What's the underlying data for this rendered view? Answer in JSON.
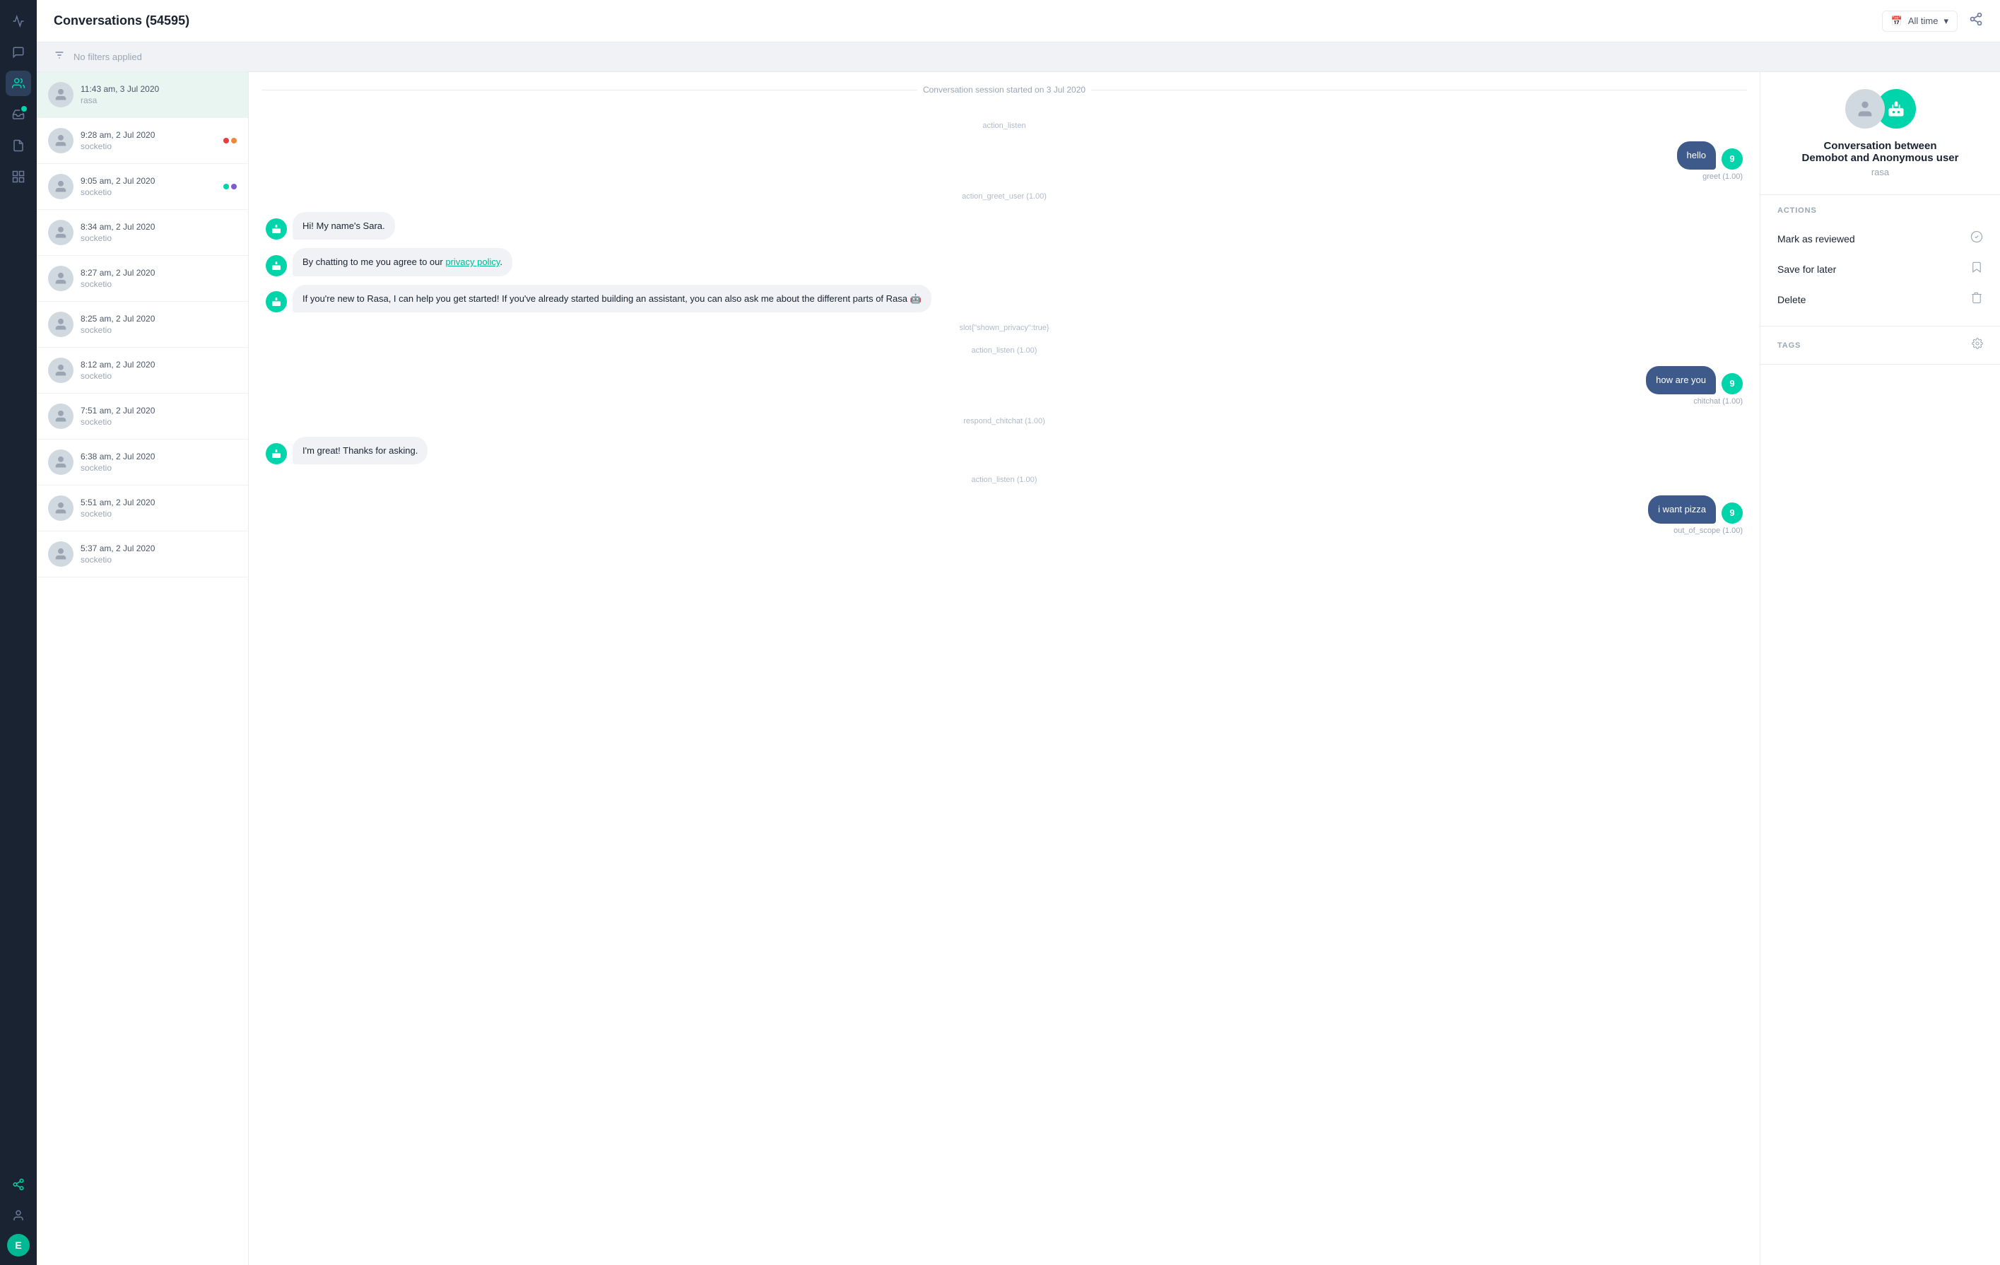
{
  "sidebar": {
    "icons": [
      "chart-line",
      "chat-bubble",
      "conversations",
      "inbox",
      "document",
      "analytics",
      "person"
    ],
    "avatar_letter": "E"
  },
  "header": {
    "title": "Conversations (54595)",
    "time_filter": "All time",
    "share_label": "share"
  },
  "filter_bar": {
    "placeholder": "No filters applied"
  },
  "conv_list": {
    "items": [
      {
        "time": "11:43 am, 3 Jul 2020",
        "name": "rasa",
        "dots": [],
        "selected": true
      },
      {
        "time": "9:28 am, 2 Jul 2020",
        "name": "socketio",
        "dots": [
          "red",
          "orange"
        ],
        "selected": false
      },
      {
        "time": "9:05 am, 2 Jul 2020",
        "name": "socketio",
        "dots": [
          "teal",
          "purple"
        ],
        "selected": false
      },
      {
        "time": "8:34 am, 2 Jul 2020",
        "name": "socketio",
        "dots": [],
        "selected": false
      },
      {
        "time": "8:27 am, 2 Jul 2020",
        "name": "socketio",
        "dots": [],
        "selected": false
      },
      {
        "time": "8:25 am, 2 Jul 2020",
        "name": "socketio",
        "dots": [],
        "selected": false
      },
      {
        "time": "8:12 am, 2 Jul 2020",
        "name": "socketio",
        "dots": [],
        "selected": false
      },
      {
        "time": "7:51 am, 2 Jul 2020",
        "name": "socketio",
        "dots": [],
        "selected": false
      },
      {
        "time": "6:38 am, 2 Jul 2020",
        "name": "socketio",
        "dots": [],
        "selected": false
      },
      {
        "time": "5:51 am, 2 Jul 2020",
        "name": "socketio",
        "dots": [],
        "selected": false
      },
      {
        "time": "5:37 am, 2 Jul 2020",
        "name": "socketio",
        "dots": [],
        "selected": false
      }
    ]
  },
  "chat": {
    "session_header": "Conversation session started on 3 Jul 2020",
    "messages": [
      {
        "type": "action",
        "text": "action_listen"
      },
      {
        "type": "user",
        "text": "hello",
        "intent": "greet (1.00)",
        "num": "9"
      },
      {
        "type": "action",
        "text": "action_greet_user (1.00)"
      },
      {
        "type": "bot",
        "text": "Hi! My name's Sara."
      },
      {
        "type": "bot",
        "text": "By chatting to me you agree to our privacy policy.",
        "has_link": true
      },
      {
        "type": "bot",
        "text": "If you're new to Rasa, I can help you get started! If you've already started building an assistant, you can also ask me about the different parts of Rasa 🤖"
      },
      {
        "type": "slot",
        "text": "slot{\"shown_privacy\":true}"
      },
      {
        "type": "action",
        "text": "action_listen (1.00)"
      },
      {
        "type": "user",
        "text": "how are you",
        "intent": "chitchat (1.00)",
        "num": "9"
      },
      {
        "type": "action",
        "text": "respond_chitchat (1.00)"
      },
      {
        "type": "bot",
        "text": "I'm great! Thanks for asking."
      },
      {
        "type": "action",
        "text": "action_listen (1.00)"
      },
      {
        "type": "user",
        "text": "i want pizza",
        "intent": "out_of_scope (1.00)",
        "num": "9"
      }
    ]
  },
  "right_panel": {
    "conv_title": "Conversation between",
    "conv_subtitle": "Demobot and Anonymous user",
    "tracker": "rasa",
    "actions_title": "ACTIONS",
    "actions": [
      {
        "label": "Mark as reviewed",
        "icon": "✓"
      },
      {
        "label": "Save for later",
        "icon": "🔖"
      },
      {
        "label": "Delete",
        "icon": "🗑"
      }
    ],
    "tags_title": "TAGS"
  }
}
